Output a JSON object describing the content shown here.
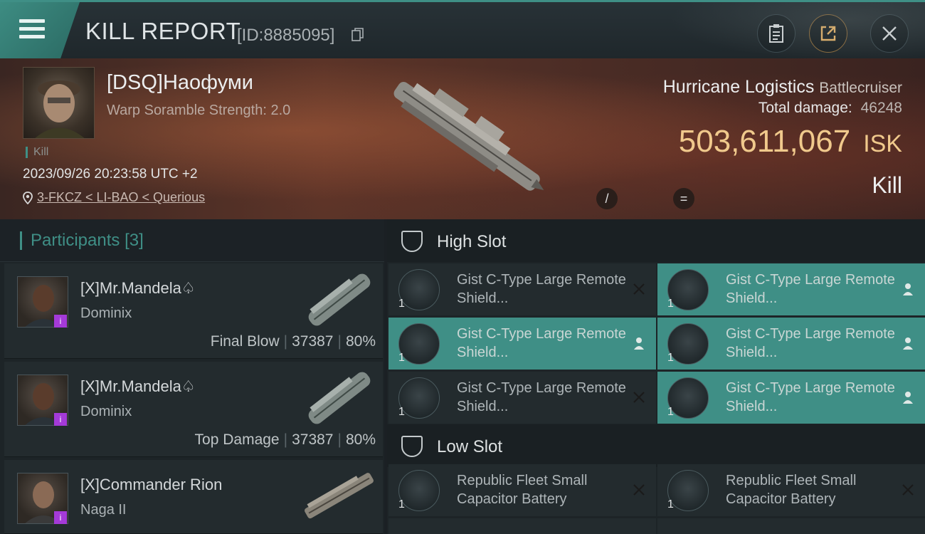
{
  "header": {
    "title": "KILL REPORT",
    "report_id": "[ID:8885095]",
    "icons": [
      "menu-icon",
      "copy-icon",
      "clipboard-icon",
      "share-icon",
      "close-icon"
    ]
  },
  "victim": {
    "name": "[DSQ]Наофуми",
    "scramble": "Warp Soramble Strength: 2.0",
    "tag": "Kill",
    "time": "2023/09/26 20:23:58 UTC +2",
    "location": "3-FKCZ < LI-BAO < Querious",
    "ship_name": "Hurricane Logistics",
    "ship_class": "Battlecruiser",
    "total_damage_label": "Total damage:",
    "total_damage": "46248",
    "isk_value": "503,611,067",
    "isk_unit": "ISK",
    "result": "Kill",
    "mini_icon_1": "/",
    "mini_icon_2": "="
  },
  "participants": {
    "title": "Participants",
    "count": "[3]",
    "items": [
      {
        "name": "[X]Mr.Mandela♤",
        "ship": "Dominix",
        "role": "Final Blow",
        "damage": "37387",
        "percent": "80%",
        "badge": "i"
      },
      {
        "name": "[X]Mr.Mandela♤",
        "ship": "Dominix",
        "role": "Top Damage",
        "damage": "37387",
        "percent": "80%",
        "badge": "i"
      },
      {
        "name": "[X]Commander Rion",
        "ship": "Naga II",
        "badge": "i"
      }
    ]
  },
  "slots": {
    "high": {
      "label": "High Slot",
      "items": [
        {
          "qty": "1",
          "name": "Gist C-Type Large Remote Shield...",
          "status": "destroyed"
        },
        {
          "qty": "1",
          "name": "Gist C-Type Large Remote Shield...",
          "status": "dropped"
        },
        {
          "qty": "1",
          "name": "Gist C-Type Large Remote Shield...",
          "status": "dropped"
        },
        {
          "qty": "1",
          "name": "Gist C-Type Large Remote Shield...",
          "status": "dropped"
        },
        {
          "qty": "1",
          "name": "Gist C-Type Large Remote Shield...",
          "status": "destroyed"
        },
        {
          "qty": "1",
          "name": "Gist C-Type Large Remote Shield...",
          "status": "dropped"
        }
      ]
    },
    "low": {
      "label": "Low Slot",
      "items": [
        {
          "qty": "1",
          "name": "Republic Fleet Small Capacitor Battery",
          "status": "destroyed"
        },
        {
          "qty": "1",
          "name": "Republic Fleet Small Capacitor Battery",
          "status": "destroyed"
        }
      ]
    }
  },
  "colors": {
    "accent": "#3f8f86",
    "isk": "#f0c98c",
    "badge": "#a43ad8"
  }
}
